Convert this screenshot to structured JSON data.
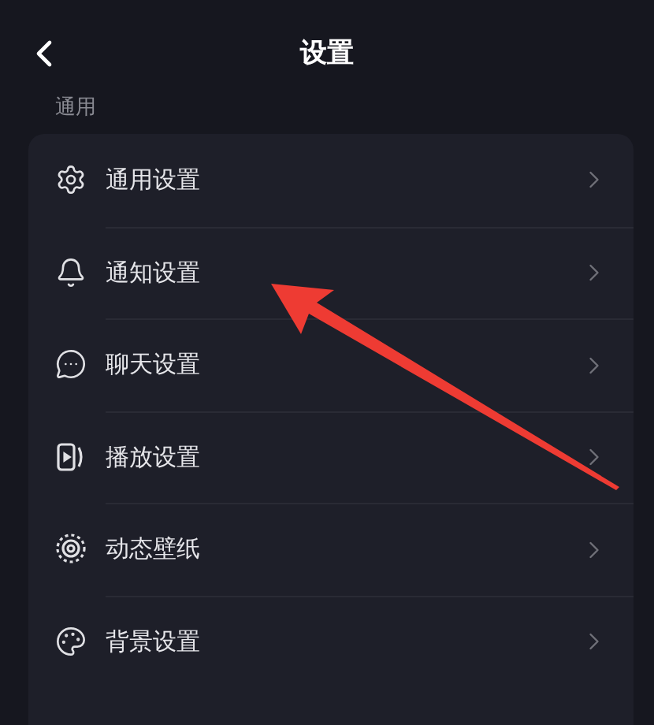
{
  "header": {
    "title": "设置"
  },
  "sections": [
    {
      "label": "通用",
      "items": [
        {
          "label": "通用设置"
        },
        {
          "label": "通知设置"
        },
        {
          "label": "聊天设置"
        },
        {
          "label": "播放设置"
        },
        {
          "label": "动态壁纸"
        },
        {
          "label": "背景设置"
        }
      ]
    }
  ]
}
